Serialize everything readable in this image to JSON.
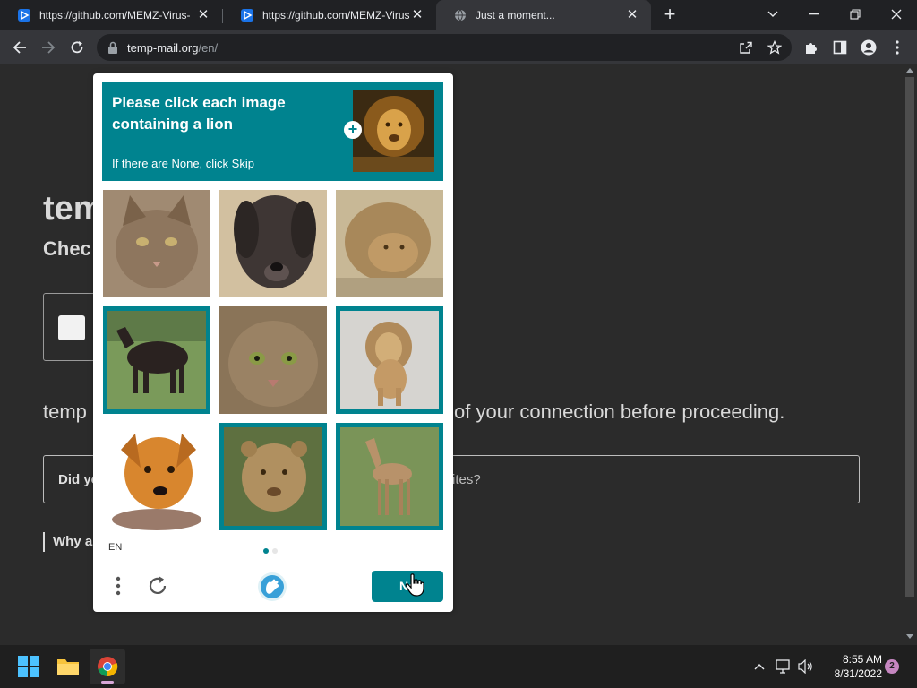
{
  "browser": {
    "tabs": [
      {
        "title": "https://github.com/MEMZ-Virus-",
        "icon": "github-play-icon"
      },
      {
        "title": "https://github.com/MEMZ-Virus-",
        "icon": "github-play-icon"
      },
      {
        "title": "Just a moment...",
        "icon": "globe-icon",
        "active": true
      }
    ],
    "tab_close": "✕",
    "new_tab": "+",
    "url_host": "temp-mail.org",
    "url_path": "/en/"
  },
  "page": {
    "site_title": "tem",
    "site_subtitle": "Chec",
    "verify_left": "temp",
    "verify_right": "of your connection before proceeding.",
    "faq_left": "Did yo",
    "faq_right": "ites?",
    "why": "Why a"
  },
  "captcha": {
    "prompt_line": "Please click each image containing a lion",
    "prompt_sub": "If there are None, click Skip",
    "plus": "+",
    "language": "EN",
    "next_label": "Ne",
    "tiles": [
      {
        "subject": "cat",
        "selected": false
      },
      {
        "subject": "dog",
        "selected": false
      },
      {
        "subject": "lion",
        "selected": false
      },
      {
        "subject": "horse",
        "selected": true
      },
      {
        "subject": "cat",
        "selected": false
      },
      {
        "subject": "lion",
        "selected": true
      },
      {
        "subject": "dog",
        "selected": false
      },
      {
        "subject": "lion cub",
        "selected": true
      },
      {
        "subject": "foal",
        "selected": true
      }
    ],
    "accent": "#00838f"
  },
  "taskbar": {
    "time": "8:55 AM",
    "date": "8/31/2022",
    "notifications": "2"
  }
}
